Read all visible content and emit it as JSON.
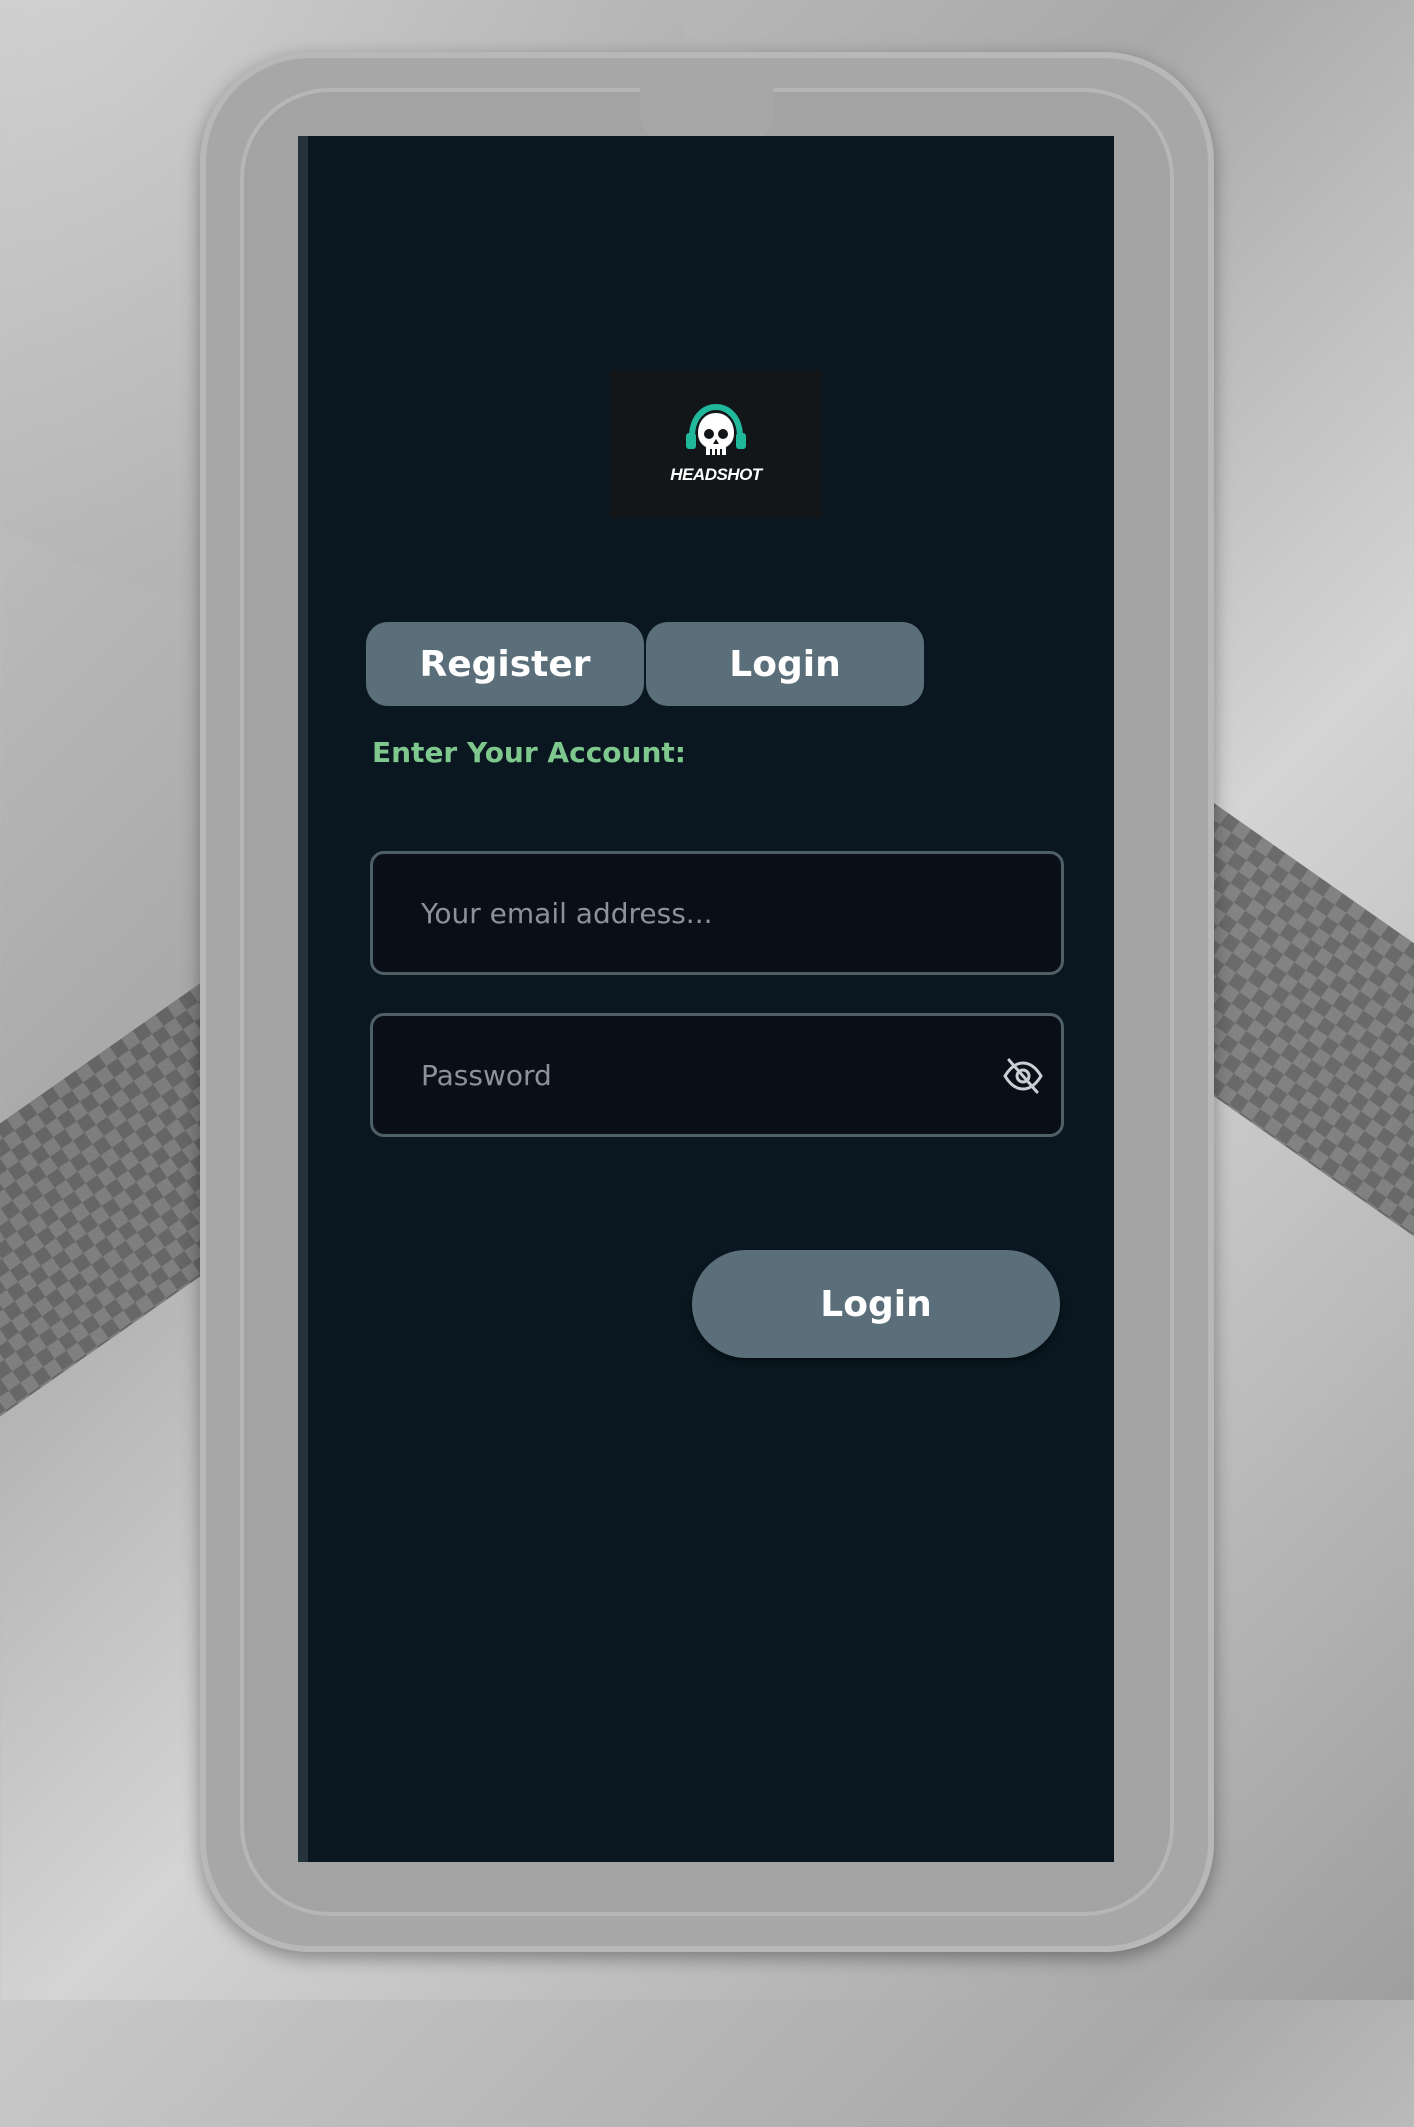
{
  "brand": {
    "logo_text": "HEADSHOT",
    "logo_icon": "skull-headset-icon",
    "logo_accent": "#1fb89a"
  },
  "tabs": [
    {
      "label": "Register"
    },
    {
      "label": "Login"
    }
  ],
  "form": {
    "heading": "Enter Your Account:",
    "email_placeholder": "Your email address...",
    "password_placeholder": "Password",
    "password_toggle_icon": "eye-off-icon",
    "submit_label": "Login"
  },
  "colors": {
    "screen_bg": "#0a1720",
    "button_bg": "#5a6f7a",
    "heading_color": "#7fc88d",
    "field_border": "#4f5f68"
  }
}
